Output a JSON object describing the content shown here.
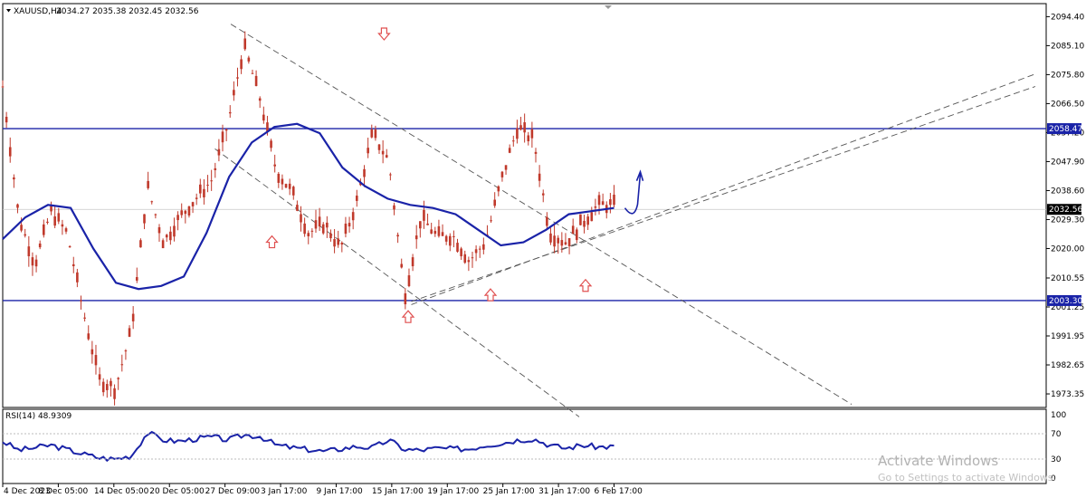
{
  "header": {
    "symbol": "XAUUSD,H4",
    "ohlc": "2034.27 2035.38 2032.45 2032.56"
  },
  "rsi_header": "RSI(14) 48.9309",
  "watermark": {
    "title": "Activate Windows",
    "subtitle": "Go to Settings to activate Windows."
  },
  "colors": {
    "candle": "#c0392b",
    "ma_line": "#1a23a8",
    "level_line": "#1a23a8",
    "trend_line": "#555555",
    "arrow": "#e05050",
    "price_tag_bg": "#1a23a8",
    "current_tag_bg": "#000000"
  },
  "chart_data": [
    {
      "type": "candlestick",
      "title": "XAUUSD,H4",
      "price_axis_ticks": [
        "2094.40",
        "2085.10",
        "2075.80",
        "2066.50",
        "2057.20",
        "2047.90",
        "2038.60",
        "2029.30",
        "2020.00",
        "2010.55",
        "2001.25",
        "1991.95",
        "1982.65",
        "1973.35"
      ],
      "time_axis_ticks": [
        "4 Dec 2023",
        "8 Dec 05:00",
        "14 Dec 05:00",
        "20 Dec 05:00",
        "27 Dec 09:00",
        "3 Jan 17:00",
        "9 Jan 17:00",
        "15 Jan 17:00",
        "19 Jan 17:00",
        "25 Jan 17:00",
        "31 Jan 17:00",
        "6 Feb 17:00"
      ],
      "ylim": [
        1969,
        2098
      ],
      "horizontal_levels": [
        {
          "label": "2058.47",
          "value": 2058.47
        },
        {
          "label": "2003.30",
          "value": 2003.3
        }
      ],
      "current_price": {
        "label": "2032.56",
        "value": 2032.56
      },
      "moving_average": [
        2023,
        2030,
        2034,
        2033,
        2020,
        2009,
        2007,
        2008,
        2011,
        2025,
        2043,
        2054,
        2059,
        2060,
        2057,
        2046,
        2040,
        2036,
        2034,
        2033,
        2031,
        2026,
        2021,
        2022,
        2026,
        2031,
        2032,
        2033
      ],
      "price_path": [
        2072,
        2030,
        2015,
        2032,
        2025,
        2000,
        1978,
        1975,
        1994,
        2040,
        2022,
        2030,
        2036,
        2042,
        2060,
        2085,
        2068,
        2045,
        2038,
        2025,
        2028,
        2020,
        2035,
        2057,
        2048,
        2005,
        2030,
        2024,
        2024,
        2016,
        2022,
        2042,
        2059,
        2055,
        2025,
        2022,
        2028,
        2034,
        2034
      ]
    },
    {
      "type": "line",
      "title": "RSI(14) 48.9309",
      "ylim": [
        0,
        100
      ],
      "y_ticks": [
        "100",
        "70",
        "30",
        "0"
      ],
      "values": [
        58,
        44,
        48,
        52,
        45,
        38,
        32,
        30,
        35,
        72,
        60,
        58,
        62,
        65,
        60,
        68,
        66,
        52,
        48,
        45,
        42,
        46,
        50,
        48,
        60,
        45,
        44,
        47,
        46,
        46,
        52,
        55,
        60,
        62,
        52,
        47,
        52,
        49,
        50
      ]
    }
  ]
}
